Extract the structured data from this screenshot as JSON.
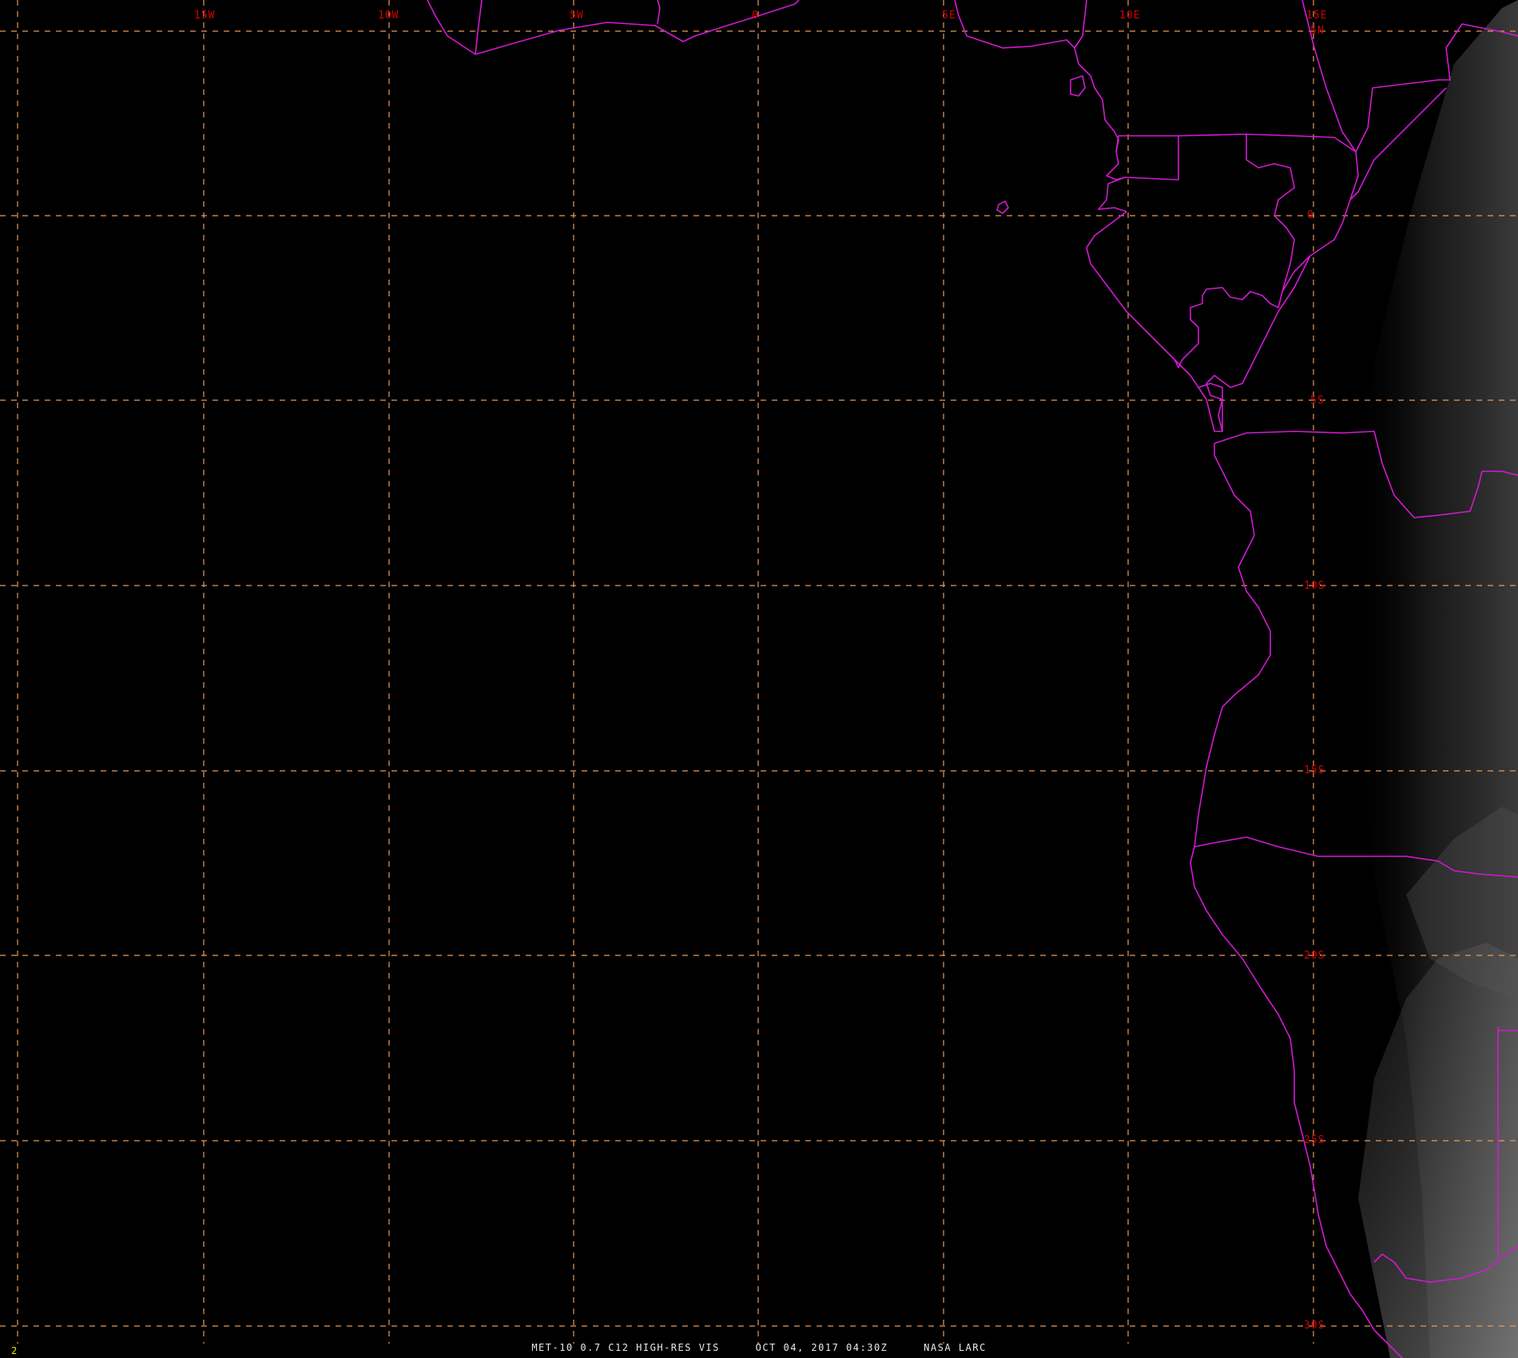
{
  "map": {
    "longitude_labels": [
      "15W",
      "10W",
      "5W",
      "0",
      "5E",
      "10E",
      "15E"
    ],
    "latitude_labels": [
      "5N",
      "0",
      "5S",
      "10S",
      "15S",
      "20S",
      "25S",
      "30S"
    ]
  },
  "caption": {
    "product": "MET-10 0.7 C12 HIGH-RES VIS",
    "datetime": "OCT 04, 2017 04:30Z",
    "source": "NASA LARC"
  },
  "frame_number": "2",
  "colors": {
    "background": "#000000",
    "grid": "#e89a5a",
    "borders": "#d21ad2",
    "labels": "#d40000",
    "caption": "#e8e8e8",
    "frame_number": "#e8e800"
  }
}
